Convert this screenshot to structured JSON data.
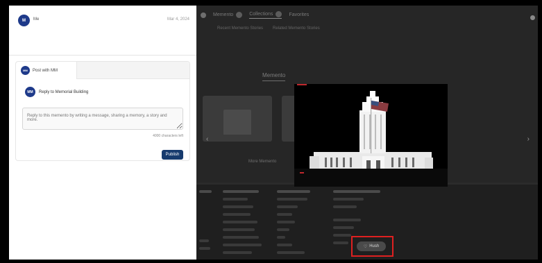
{
  "left_panel": {
    "header": {
      "avatar_initials": "M",
      "name": "Me",
      "date": "Mar 4, 2024"
    },
    "tab": {
      "avatar_initials": "MM",
      "label": "Post with MM"
    },
    "reply": {
      "avatar_initials": "MM",
      "label": "Reply to Memorial Building"
    },
    "message_placeholder": "Reply to this memento by writing a message, sharing a memory, a story and more.",
    "char_count": "4000 characters left",
    "publish_label": "Publish"
  },
  "background": {
    "tabs": [
      "Memento",
      "Collections",
      "Favorites"
    ],
    "sub_tabs": [
      "Recent Memento Stories",
      "Related Memento Stories"
    ],
    "section_title": "Memento",
    "more_link": "More Memento"
  },
  "lightbox": {
    "image_alt_icon": "memorial-building-photo"
  },
  "highlighted_button": {
    "label": "Hush",
    "icon": "heart-icon",
    "color": "#e02020"
  },
  "colors": {
    "primary": "#173b6e",
    "avatar": "#1e3a8a",
    "highlight": "#e02020",
    "overlay": "#262626"
  }
}
